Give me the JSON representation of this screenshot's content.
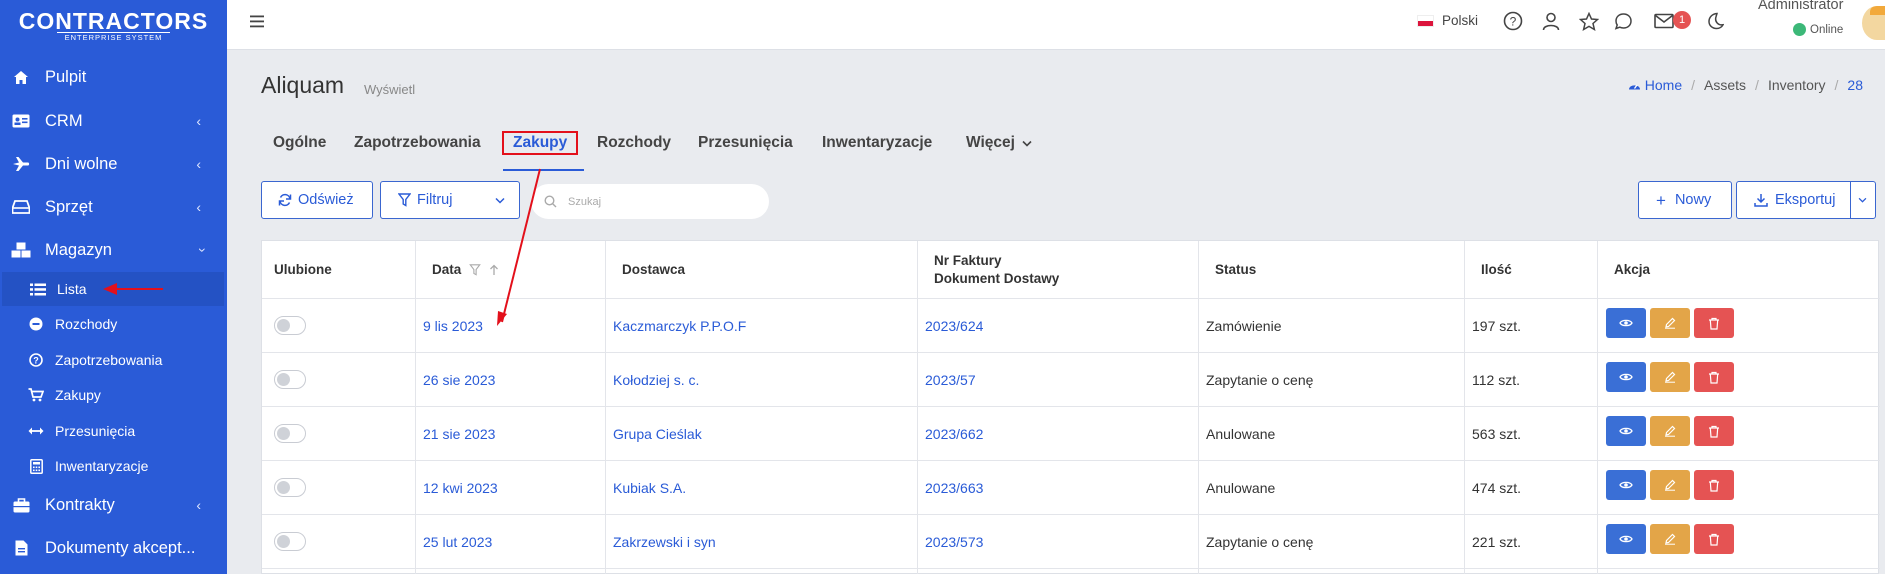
{
  "logo": {
    "title": "CONTRACTORS",
    "subtitle": "ENTERPRISE SYSTEM"
  },
  "sidebar": {
    "items": [
      {
        "label": "Pulpit"
      },
      {
        "label": "CRM"
      },
      {
        "label": "Dni wolne"
      },
      {
        "label": "Sprzęt"
      },
      {
        "label": "Magazyn"
      }
    ],
    "magazyn_sub": [
      {
        "label": "Lista"
      },
      {
        "label": "Rozchody"
      },
      {
        "label": "Zapotrzebowania"
      },
      {
        "label": "Zakupy"
      },
      {
        "label": "Przesunięcia"
      },
      {
        "label": "Inwentaryzacje"
      }
    ],
    "after": [
      {
        "label": "Kontrakty"
      },
      {
        "label": "Dokumenty akcept..."
      }
    ]
  },
  "topbar": {
    "language": "Polski",
    "mail_badge": "1",
    "user_name": "Administrator",
    "user_status": "Online"
  },
  "page": {
    "title": "Aliquam",
    "subtitle": "Wyświetl",
    "breadcrumb": [
      "Home",
      "Assets",
      "Inventory",
      "28"
    ]
  },
  "tabs": [
    "Ogólne",
    "Zapotrzebowania",
    "Zakupy",
    "Rozchody",
    "Przesunięcia",
    "Inwentaryzacje",
    "Więcej"
  ],
  "active_tab": "Zakupy",
  "toolbar": {
    "refresh": "Odśwież",
    "filter": "Filtruj",
    "search_placeholder": "Szukaj",
    "new": "Nowy",
    "export": "Eksportuj"
  },
  "table": {
    "headers": {
      "favorite": "Ulubione",
      "date": "Data",
      "supplier": "Dostawca",
      "invoice_line1": "Nr Faktury",
      "invoice_line2": "Dokument Dostawy",
      "status": "Status",
      "quantity": "Ilość",
      "action": "Akcja"
    },
    "rows": [
      {
        "date": "9 lis 2023",
        "supplier": "Kaczmarczyk P.P.O.F",
        "invoice": "2023/624",
        "status": "Zamówienie",
        "quantity": "197 szt."
      },
      {
        "date": "26 sie 2023",
        "supplier": "Kołodziej s. c.",
        "invoice": "2023/57",
        "status": "Zapytanie o cenę",
        "quantity": "112 szt."
      },
      {
        "date": "21 sie 2023",
        "supplier": "Grupa Cieślak",
        "invoice": "2023/662",
        "status": "Anulowane",
        "quantity": "563 szt."
      },
      {
        "date": "12 kwi 2023",
        "supplier": "Kubiak S.A.",
        "invoice": "2023/663",
        "status": "Anulowane",
        "quantity": "474 szt."
      },
      {
        "date": "25 lut 2023",
        "supplier": "Zakrzewski i syn",
        "invoice": "2023/573",
        "status": "Zapytanie o cenę",
        "quantity": "221 szt."
      }
    ]
  },
  "colors": {
    "sidebar": "#2a5bd7",
    "accent": "#2a5bd7",
    "annotation": "#e3101b",
    "view": "#3a6fd6",
    "edit": "#e3a548",
    "delete": "#e55353"
  }
}
